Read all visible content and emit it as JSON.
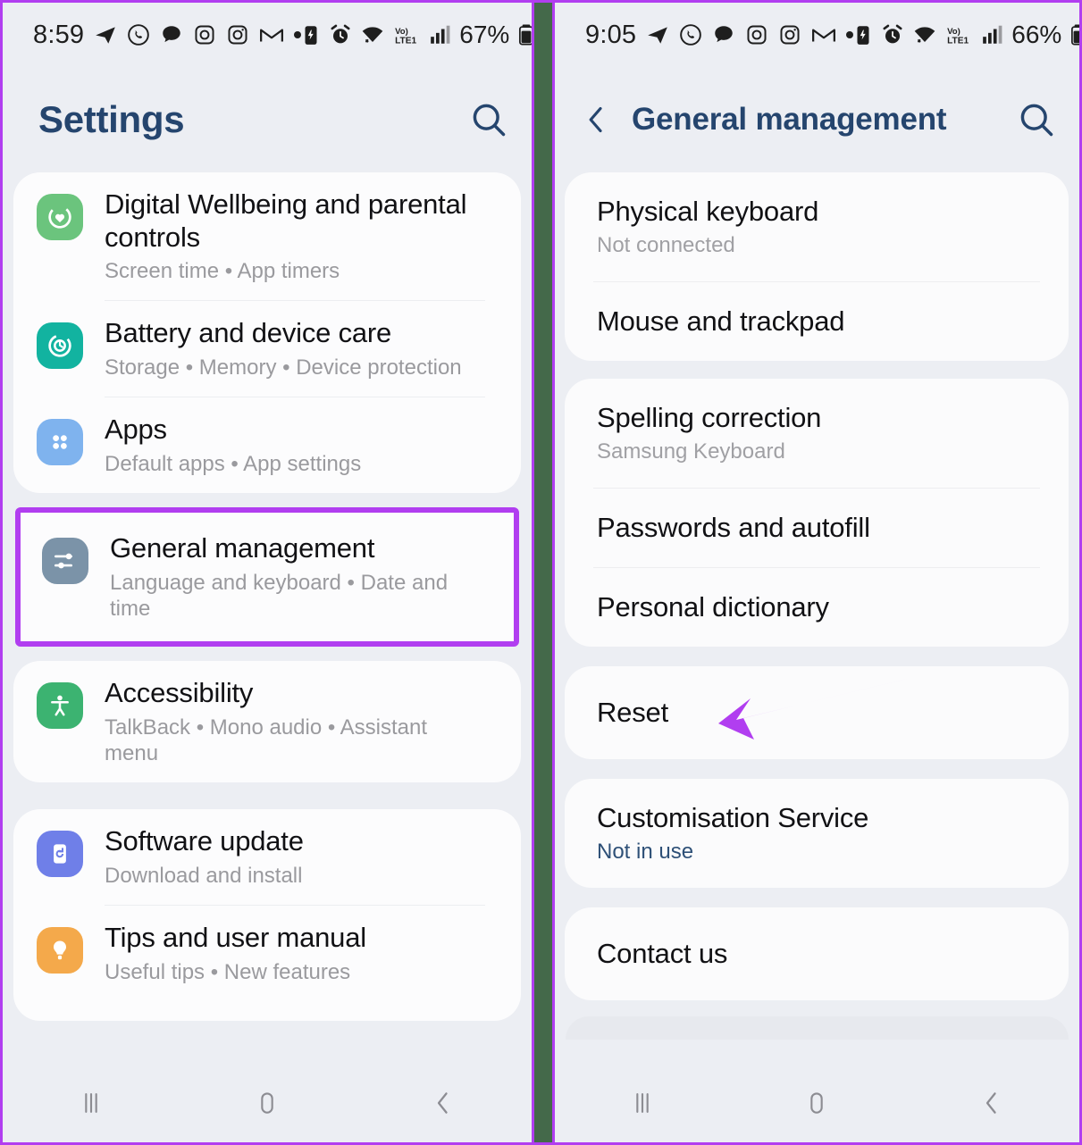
{
  "annotation": {
    "frame_color": "#b13ef0",
    "divider_color": "#44694a",
    "highlight_color": "#b13ef0",
    "arrow_color": "#b13ef0"
  },
  "left_phone": {
    "status_bar": {
      "time": "8:59",
      "battery": "67%",
      "network": "LTE1",
      "voice_badge": "Vo)",
      "icons": [
        "telegram-icon",
        "whatsapp-icon",
        "chat-bubble-icon",
        "instagram-icon",
        "instagram-icon",
        "gmail-icon",
        "dot-icon"
      ],
      "right_icons": [
        "battery-saver-icon",
        "alarm-icon",
        "wifi-icon",
        "volte-icon",
        "signal-icon",
        "battery-icon"
      ]
    },
    "header": {
      "title": "Settings",
      "search_icon": "search-icon"
    },
    "cards": [
      {
        "items": [
          {
            "title": "Digital Wellbeing and parental controls",
            "subtitle": "Screen time  •  App timers",
            "icon": "wellbeing-icon",
            "icon_color": "#6bc47d"
          },
          {
            "title": "Battery and device care",
            "subtitle": "Storage  •  Memory  •  Device protection",
            "icon": "battery-care-icon",
            "icon_color": "#12b3a0"
          },
          {
            "title": "Apps",
            "subtitle": "Default apps  •  App settings",
            "icon": "apps-grid-icon",
            "icon_color": "#7fb3ee"
          }
        ]
      }
    ],
    "highlighted_item": {
      "title": "General management",
      "subtitle": "Language and keyboard  •  Date and time",
      "icon": "sliders-icon",
      "icon_color": "#7b93a8"
    },
    "card_after_highlight": {
      "items": [
        {
          "title": "Accessibility",
          "subtitle": "TalkBack  •  Mono audio  •  Assistant menu",
          "icon": "accessibility-icon",
          "icon_color": "#3cb371"
        }
      ]
    },
    "last_card": {
      "items": [
        {
          "title": "Software update",
          "subtitle": "Download and install",
          "icon": "software-update-icon",
          "icon_color": "#6f7fe8"
        },
        {
          "title": "Tips and user manual",
          "subtitle": "Useful tips  •  New features",
          "icon": "lightbulb-icon",
          "icon_color": "#f4a94b"
        }
      ]
    },
    "nav_bar": {
      "recents": "recents-icon",
      "home": "home-icon",
      "back": "back-icon"
    }
  },
  "right_phone": {
    "status_bar": {
      "time": "9:05",
      "battery": "66%",
      "network": "LTE1",
      "voice_badge": "Vo)",
      "icons": [
        "telegram-icon",
        "whatsapp-icon",
        "chat-bubble-icon",
        "instagram-icon",
        "instagram-icon",
        "gmail-icon",
        "dot-icon"
      ],
      "right_icons": [
        "battery-saver-icon",
        "alarm-icon",
        "wifi-icon",
        "volte-icon",
        "signal-icon",
        "battery-icon"
      ]
    },
    "header": {
      "back_icon": "chevron-left-icon",
      "title": "General management",
      "search_icon": "search-icon"
    },
    "cards": [
      {
        "items": [
          {
            "title": "Physical keyboard",
            "subtitle": "Not connected",
            "subtitle_style": "muted"
          },
          {
            "title": "Mouse and trackpad",
            "subtitle": "",
            "subtitle_style": "none"
          }
        ]
      },
      {
        "items": [
          {
            "title": "Spelling correction",
            "subtitle": "Samsung Keyboard",
            "subtitle_style": "muted"
          },
          {
            "title": "Passwords and autofill",
            "subtitle": "",
            "subtitle_style": "none"
          },
          {
            "title": "Personal dictionary",
            "subtitle": "",
            "subtitle_style": "none"
          }
        ]
      },
      {
        "items": [
          {
            "title": "Reset",
            "subtitle": "",
            "subtitle_style": "none",
            "annotated": true
          }
        ]
      },
      {
        "items": [
          {
            "title": "Customisation Service",
            "subtitle": "Not in use",
            "subtitle_style": "link"
          }
        ]
      },
      {
        "items": [
          {
            "title": "Contact us",
            "subtitle": "",
            "subtitle_style": "none"
          }
        ]
      }
    ],
    "nav_bar": {
      "recents": "recents-icon",
      "home": "home-icon",
      "back": "back-icon"
    }
  }
}
